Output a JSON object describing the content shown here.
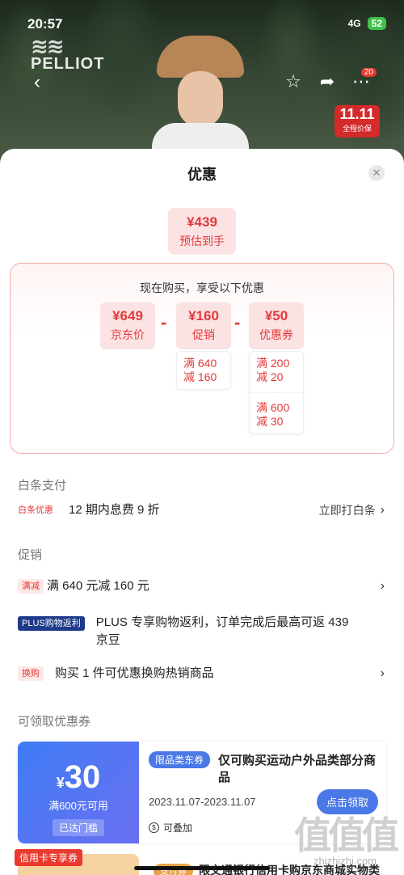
{
  "status": {
    "time": "20:57",
    "signal": "4G",
    "battery": "52"
  },
  "hero": {
    "brand": "PELLIOT",
    "promo_big": "11.11",
    "promo_small": "全程价保",
    "cart_count": "20"
  },
  "icons": {
    "back": "back-arrow-icon",
    "favorite": "star-icon",
    "share": "share-icon",
    "more": "more-icon",
    "close": "close-icon"
  },
  "sheet": {
    "title": "优惠"
  },
  "estimate": {
    "price": "¥439",
    "label": "预估到手"
  },
  "calc": {
    "title": "现在购买，享受以下优惠",
    "jd_price": {
      "value": "¥649",
      "label": "京东价"
    },
    "promo": {
      "value": "¥160",
      "label": "促销"
    },
    "coupon": {
      "value": "¥50",
      "label": "优惠券"
    },
    "minus": "-",
    "promo_conds": [
      {
        "line1": "满 640",
        "line2": "减 160"
      }
    ],
    "coupon_conds": [
      {
        "line1": "满 200",
        "line2": "减 20"
      },
      {
        "line1": "满 600",
        "line2": "减 30"
      }
    ]
  },
  "baitiao": {
    "heading": "白条支付",
    "tag": "白条优惠",
    "text": "12 期内息费 9 折",
    "action": "立即打白条"
  },
  "promotion": {
    "heading": "促销",
    "items": [
      {
        "tag": "满减",
        "text": "满 640 元减 160 元"
      },
      {
        "tag": "PLUS购物返利",
        "text": "PLUS 专享购物返利，订单完成后最高可返 439 京豆"
      },
      {
        "tag": "换购",
        "text": "购买 1 件可优惠换购热销商品"
      }
    ]
  },
  "coupons": {
    "heading": "可领取优惠券",
    "first": {
      "currency": "¥",
      "amount": "30",
      "condition": "满600元可用",
      "reached": "已达门槛",
      "tag": "限品类东券",
      "name": "仅可购买运动户外品类部分商品",
      "date": "2023.11.07-2023.11.07",
      "claim": "点击领取",
      "stack": "可叠加"
    },
    "second": {
      "tag": "信用卡专享券",
      "tag2": "支付券",
      "name": "限交通银行信用卡购京东商城实物类"
    }
  },
  "watermark": {
    "logo": "值值值",
    "site": "zhizhizhi.com"
  }
}
